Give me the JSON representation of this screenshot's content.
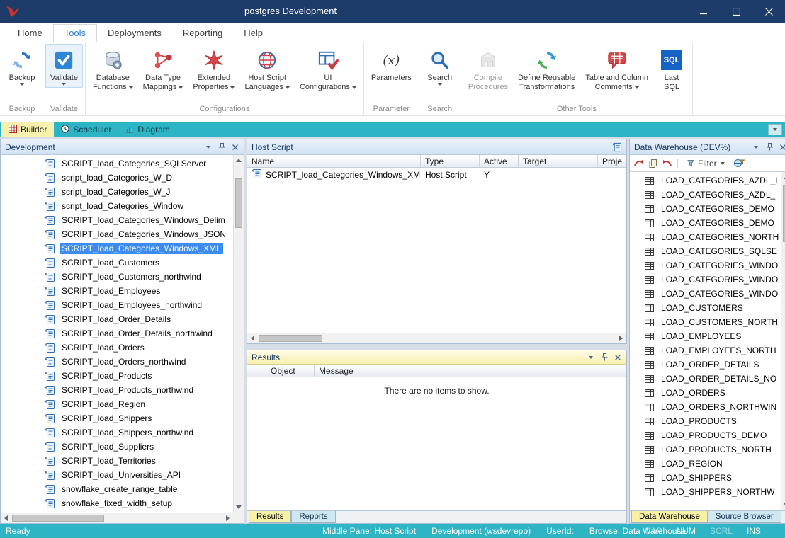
{
  "window": {
    "title": "postgres Development"
  },
  "menubar": {
    "tabs": [
      {
        "label": "Home"
      },
      {
        "label": "Tools",
        "active": true
      },
      {
        "label": "Deployments"
      },
      {
        "label": "Reporting"
      },
      {
        "label": "Help"
      }
    ]
  },
  "ribbon": {
    "backup": {
      "line1": "Backup"
    },
    "validate": {
      "line1": "Validate"
    },
    "database_functions": {
      "line1": "Database",
      "line2": "Functions"
    },
    "data_type_mappings": {
      "line1": "Data Type",
      "line2": "Mappings"
    },
    "extended_properties": {
      "line1": "Extended",
      "line2": "Properties"
    },
    "host_script_languages": {
      "line1": "Host Script",
      "line2": "Languages"
    },
    "ui_configurations": {
      "line1": "UI",
      "line2": "Configurations"
    },
    "parameters": {
      "line1": "Parameters"
    },
    "search": {
      "line1": "Search"
    },
    "compile_procedures": {
      "line1": "Compile",
      "line2": "Procedures"
    },
    "define_reusable_transformations": {
      "line1": "Define Reusable",
      "line2": "Transformations"
    },
    "table_and_column_comments": {
      "line1": "Table and Column",
      "line2": "Comments"
    },
    "last_sql": {
      "line1": "Last",
      "line2": "SQL"
    },
    "last_sql_icon_text": "SQL",
    "parameters_icon_text": "(x)",
    "captions": {
      "backup": "Backup",
      "validate": "Validate",
      "configurations": "Configurations",
      "parameter": "Parameter",
      "search": "Search",
      "other_tools": "Other Tools"
    }
  },
  "view_tabs": {
    "tabs": [
      {
        "label": "Builder",
        "active": true
      },
      {
        "label": "Scheduler"
      },
      {
        "label": "Diagram"
      }
    ]
  },
  "left_panel": {
    "title": "Development",
    "items": [
      {
        "label": "SCRIPT_load_Categories_SQLServer"
      },
      {
        "label": "script_load_Categories_W_D"
      },
      {
        "label": "script_load_Categories_W_J"
      },
      {
        "label": "script_load_Categories_Window"
      },
      {
        "label": "SCRIPT_load_Categories_Windows_Delim"
      },
      {
        "label": "SCRIPT_load_Categories_Windows_JSON"
      },
      {
        "label": "SCRIPT_load_Categories_Windows_XML",
        "selected": true
      },
      {
        "label": "SCRIPT_load_Customers"
      },
      {
        "label": "SCRIPT_load_Customers_northwind"
      },
      {
        "label": "SCRIPT_load_Employees"
      },
      {
        "label": "SCRIPT_load_Employees_northwind"
      },
      {
        "label": "SCRIPT_load_Order_Details"
      },
      {
        "label": "SCRIPT_load_Order_Details_northwind"
      },
      {
        "label": "SCRIPT_load_Orders"
      },
      {
        "label": "SCRIPT_load_Orders_northwind"
      },
      {
        "label": "SCRIPT_load_Products"
      },
      {
        "label": "SCRIPT_load_Products_northwind"
      },
      {
        "label": "SCRIPT_load_Region"
      },
      {
        "label": "SCRIPT_load_Shippers"
      },
      {
        "label": "SCRIPT_load_Shippers_northwind"
      },
      {
        "label": "SCRIPT_load_Suppliers"
      },
      {
        "label": "SCRIPT_load_Territories"
      },
      {
        "label": "SCRIPT_load_Universities_API"
      },
      {
        "label": "snowflake_create_range_table"
      },
      {
        "label": "snowflake_fixed_width_setup"
      }
    ]
  },
  "host_script_panel": {
    "title": "Host Script",
    "columns": [
      "Name",
      "Type",
      "Active",
      "Target",
      "Proje"
    ],
    "row": {
      "name": "SCRIPT_load_Categories_Windows_XML",
      "type": "Host Script",
      "active": "Y"
    }
  },
  "results_panel": {
    "title": "Results",
    "columns": [
      "Object",
      "Message"
    ],
    "empty_message": "There are no items to show.",
    "tabs": [
      {
        "label": "Results",
        "active": true
      },
      {
        "label": "Reports"
      }
    ]
  },
  "right_panel": {
    "title": "Data Warehouse (DEV%)",
    "filter_label": "Filter",
    "items": [
      "LOAD_CATEGORIES_AZDL_I",
      "LOAD_CATEGORIES_AZDL_",
      "LOAD_CATEGORIES_DEMO",
      "LOAD_CATEGORIES_DEMO",
      "LOAD_CATEGORIES_NORTH",
      "LOAD_CATEGORIES_SQLSE",
      "LOAD_CATEGORIES_WINDO",
      "LOAD_CATEGORIES_WINDO",
      "LOAD_CATEGORIES_WINDO",
      "LOAD_CUSTOMERS",
      "LOAD_CUSTOMERS_NORTH",
      "LOAD_EMPLOYEES",
      "LOAD_EMPLOYEES_NORTH",
      "LOAD_ORDER_DETAILS",
      "LOAD_ORDER_DETAILS_NO",
      "LOAD_ORDERS",
      "LOAD_ORDERS_NORTHWIN",
      "LOAD_PRODUCTS",
      "LOAD_PRODUCTS_DEMO",
      "LOAD_PRODUCTS_NORTH",
      "LOAD_REGION",
      "LOAD_SHIPPERS",
      "LOAD_SHIPPERS_NORTHW"
    ],
    "tabs": [
      {
        "label": "Data Warehouse",
        "active": true
      },
      {
        "label": "Source Browser"
      }
    ]
  },
  "status_bar": {
    "left": "Ready",
    "middle_pane": "Middle Pane: Host Script",
    "repository": "Development (wsdevrepo)",
    "user": "UserId:",
    "browse": "Browse: Data Warehouse",
    "toggles": [
      {
        "label": "CAP",
        "dim": true
      },
      {
        "label": "NUM"
      },
      {
        "label": "SCRL",
        "dim": true
      },
      {
        "label": "INS"
      }
    ]
  }
}
